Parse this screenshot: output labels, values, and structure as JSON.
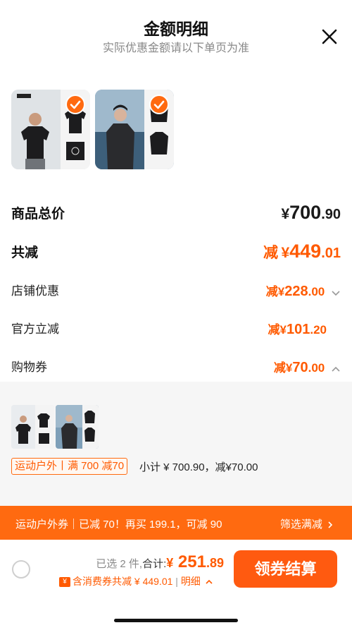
{
  "header": {
    "title": "金额明细",
    "subtitle": "实际优惠金额请以下单页为准",
    "close_icon": "close-icon"
  },
  "products": [
    {
      "name": "product-tshirt",
      "selected": true
    },
    {
      "name": "product-jacket",
      "selected": true
    }
  ],
  "summary": {
    "total": {
      "label": "商品总价",
      "currency": "¥",
      "int": "700",
      "dec": ".90"
    },
    "discount": {
      "label": "共减",
      "prefix": "减",
      "currency": "¥",
      "int": "449",
      "dec": ".01"
    }
  },
  "discount_items": [
    {
      "label": "店铺优惠",
      "prefix": "减",
      "currency": "¥",
      "int": "228",
      "dec": ".00",
      "arrow": "chevron-down-icon"
    },
    {
      "label": "官方立减",
      "prefix": "减",
      "currency": "¥",
      "int": "101",
      "dec": ".20",
      "arrow": ""
    },
    {
      "label": "购物券",
      "prefix": "减",
      "currency": "¥",
      "int": "70",
      "dec": ".00",
      "arrow": "chevron-up-icon"
    }
  ],
  "coupon_detail": {
    "tag": "运动户外丨满 700 减70",
    "subtotal": "小计 ¥ 700.90，减¥70.00"
  },
  "banner": {
    "left": "运动户外券｜已减 70！再买 199.1，可减 90",
    "right": "筛选满减",
    "right_icon": "chevron-right-icon"
  },
  "footer": {
    "selected_count": "已选 2 件,",
    "total_label": "合计:",
    "currency": "¥",
    "int": " 251",
    "dec": ".89",
    "discount_text": "含消费券共减 ¥ 449.01",
    "detail_link": "明细",
    "coupon_icon_text": "¥",
    "checkout": "领券结算"
  },
  "colors": {
    "accent": "#ff5a10",
    "text": "#1a1a1a",
    "muted": "#888888",
    "panel": "#f6f6f6"
  }
}
